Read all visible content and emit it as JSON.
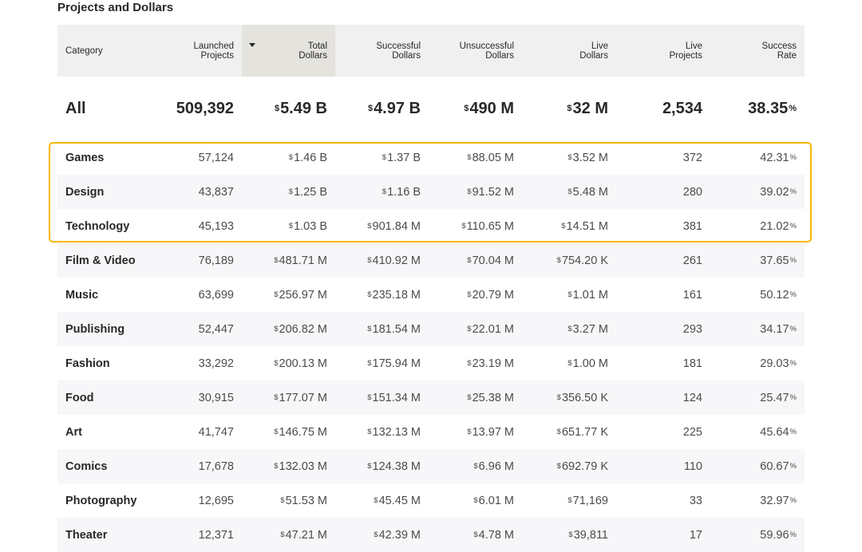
{
  "section_title": "Projects and Dollars",
  "highlight_color": "#f5b800",
  "header": {
    "category": "Category",
    "launched": [
      "Launched",
      "Projects"
    ],
    "total": [
      "Total",
      "Dollars"
    ],
    "successful": [
      "Successful",
      "Dollars"
    ],
    "unsuccessful": [
      "Unsuccessful",
      "Dollars"
    ],
    "live_dollars": [
      "Live",
      "Dollars"
    ],
    "live_projects": [
      "Live",
      "Projects"
    ],
    "success_rate": [
      "Success",
      "Rate"
    ],
    "sort_icon": "caret-down-icon"
  },
  "all_row": {
    "category": "All",
    "launched": "509,392",
    "total": "5.49 B",
    "successful": "4.97 B",
    "unsuccessful": "490 M",
    "live_dollars": "32 M",
    "live_projects": "2,534",
    "success_rate": "38.35"
  },
  "rows": [
    {
      "category": "Games",
      "launched": "57,124",
      "total": "1.46 B",
      "successful": "1.37 B",
      "unsuccessful": "88.05 M",
      "live_dollars": "3.52 M",
      "live_projects": "372",
      "success_rate": "42.31"
    },
    {
      "category": "Design",
      "launched": "43,837",
      "total": "1.25 B",
      "successful": "1.16 B",
      "unsuccessful": "91.52 M",
      "live_dollars": "5.48 M",
      "live_projects": "280",
      "success_rate": "39.02"
    },
    {
      "category": "Technology",
      "launched": "45,193",
      "total": "1.03 B",
      "successful": "901.84 M",
      "unsuccessful": "110.65 M",
      "live_dollars": "14.51 M",
      "live_projects": "381",
      "success_rate": "21.02"
    },
    {
      "category": "Film & Video",
      "launched": "76,189",
      "total": "481.71 M",
      "successful": "410.92 M",
      "unsuccessful": "70.04 M",
      "live_dollars": "754.20 K",
      "live_projects": "261",
      "success_rate": "37.65"
    },
    {
      "category": "Music",
      "launched": "63,699",
      "total": "256.97 M",
      "successful": "235.18 M",
      "unsuccessful": "20.79 M",
      "live_dollars": "1.01 M",
      "live_projects": "161",
      "success_rate": "50.12"
    },
    {
      "category": "Publishing",
      "launched": "52,447",
      "total": "206.82 M",
      "successful": "181.54 M",
      "unsuccessful": "22.01 M",
      "live_dollars": "3.27 M",
      "live_projects": "293",
      "success_rate": "34.17"
    },
    {
      "category": "Fashion",
      "launched": "33,292",
      "total": "200.13 M",
      "successful": "175.94 M",
      "unsuccessful": "23.19 M",
      "live_dollars": "1.00 M",
      "live_projects": "181",
      "success_rate": "29.03"
    },
    {
      "category": "Food",
      "launched": "30,915",
      "total": "177.07 M",
      "successful": "151.34 M",
      "unsuccessful": "25.38 M",
      "live_dollars": "356.50 K",
      "live_projects": "124",
      "success_rate": "25.47"
    },
    {
      "category": "Art",
      "launched": "41,747",
      "total": "146.75 M",
      "successful": "132.13 M",
      "unsuccessful": "13.97 M",
      "live_dollars": "651.77 K",
      "live_projects": "225",
      "success_rate": "45.64"
    },
    {
      "category": "Comics",
      "launched": "17,678",
      "total": "132.03 M",
      "successful": "124.38 M",
      "unsuccessful": "6.96 M",
      "live_dollars": "692.79 K",
      "live_projects": "110",
      "success_rate": "60.67"
    },
    {
      "category": "Photography",
      "launched": "12,695",
      "total": "51.53 M",
      "successful": "45.45 M",
      "unsuccessful": "6.01 M",
      "live_dollars": "71,169",
      "live_projects": "33",
      "success_rate": "32.97"
    },
    {
      "category": "Theater",
      "launched": "12,371",
      "total": "47.21 M",
      "successful": "42.39 M",
      "unsuccessful": "4.78 M",
      "live_dollars": "39,811",
      "live_projects": "17",
      "success_rate": "59.96"
    }
  ]
}
